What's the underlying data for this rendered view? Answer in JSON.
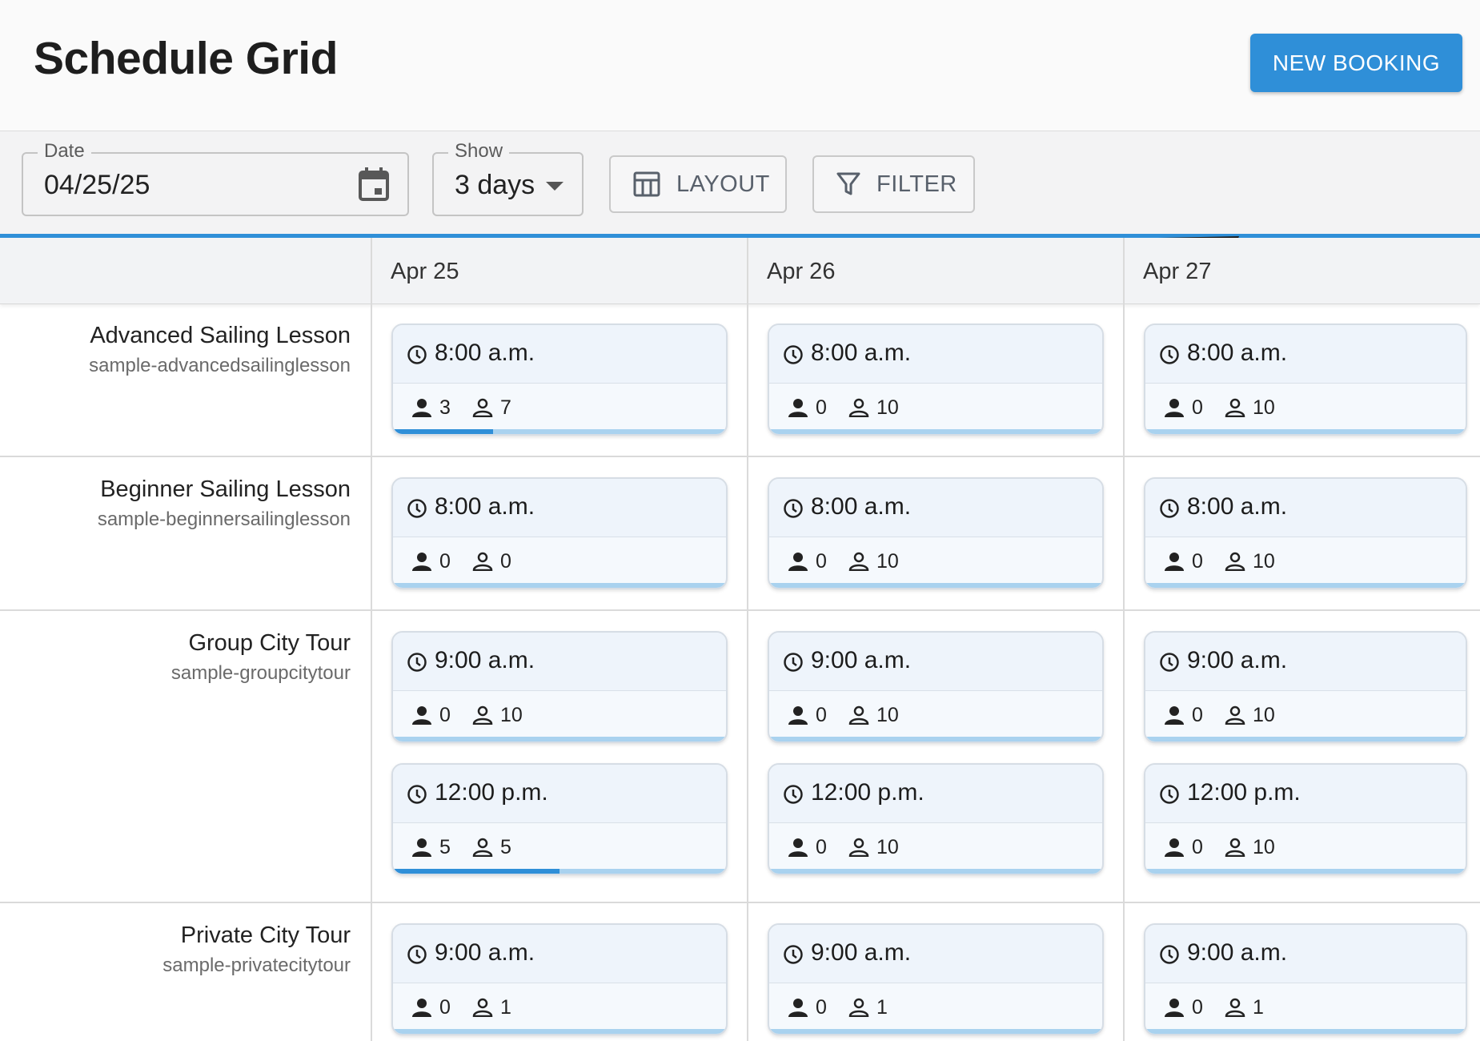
{
  "header": {
    "title": "Schedule Grid",
    "new_booking_label": "NEW BOOKING"
  },
  "toolbar": {
    "date_label": "Date",
    "date_value": "04/25/25",
    "show_label": "Show",
    "show_value": "3 days",
    "layout_label": "LAYOUT",
    "filter_label": "FILTER"
  },
  "dates": [
    "Apr 25",
    "Apr 26",
    "Apr 27"
  ],
  "resources": [
    {
      "name": "Advanced Sailing Lesson",
      "code": "sample-advancedsailinglesson",
      "slots": [
        {
          "time": "8:00 a.m.",
          "days": [
            {
              "booked": "3",
              "avail": "7",
              "fill": 0.3
            },
            {
              "booked": "0",
              "avail": "10",
              "fill": 0
            },
            {
              "booked": "0",
              "avail": "10",
              "fill": 0
            }
          ]
        }
      ]
    },
    {
      "name": "Beginner Sailing Lesson",
      "code": "sample-beginnersailinglesson",
      "slots": [
        {
          "time": "8:00 a.m.",
          "days": [
            {
              "booked": "0",
              "avail": "0",
              "fill": 0
            },
            {
              "booked": "0",
              "avail": "10",
              "fill": 0
            },
            {
              "booked": "0",
              "avail": "10",
              "fill": 0
            }
          ]
        }
      ]
    },
    {
      "name": "Group City Tour",
      "code": "sample-groupcitytour",
      "slots": [
        {
          "time": "9:00 a.m.",
          "days": [
            {
              "booked": "0",
              "avail": "10",
              "fill": 0
            },
            {
              "booked": "0",
              "avail": "10",
              "fill": 0
            },
            {
              "booked": "0",
              "avail": "10",
              "fill": 0
            }
          ]
        },
        {
          "time": "12:00 p.m.",
          "days": [
            {
              "booked": "5",
              "avail": "5",
              "fill": 0.5
            },
            {
              "booked": "0",
              "avail": "10",
              "fill": 0
            },
            {
              "booked": "0",
              "avail": "10",
              "fill": 0
            }
          ]
        }
      ]
    },
    {
      "name": "Private City Tour",
      "code": "sample-privatecitytour",
      "slots": [
        {
          "time": "9:00 a.m.",
          "days": [
            {
              "booked": "0",
              "avail": "1",
              "fill": 0
            },
            {
              "booked": "0",
              "avail": "1",
              "fill": 0
            },
            {
              "booked": "0",
              "avail": "1",
              "fill": 0
            }
          ]
        }
      ]
    }
  ]
}
